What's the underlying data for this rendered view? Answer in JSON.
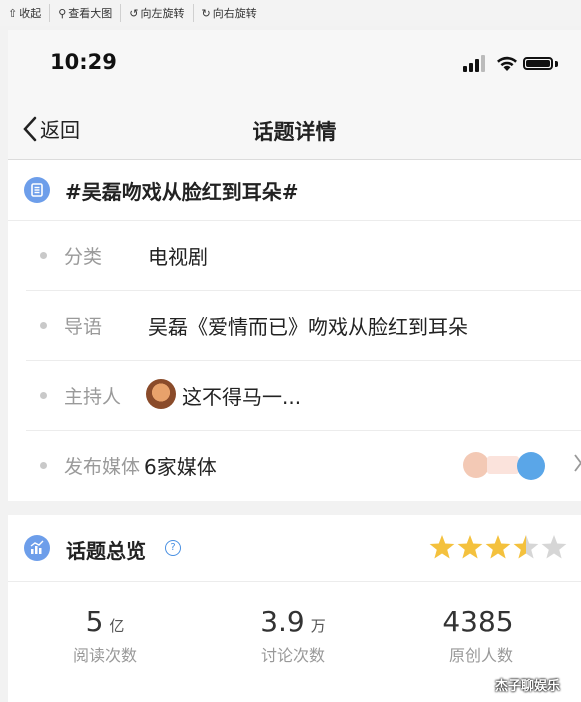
{
  "toolbar": {
    "items": [
      {
        "icon": "collapse-icon",
        "glyph": "⇧",
        "label": "收起"
      },
      {
        "icon": "search-icon",
        "glyph": "⚲",
        "label": "查看大图"
      },
      {
        "icon": "rotate-left-icon",
        "glyph": "↺",
        "label": "向左旋转"
      },
      {
        "icon": "rotate-right-icon",
        "glyph": "↻",
        "label": "向右旋转"
      }
    ]
  },
  "status_bar": {
    "time": "10:29"
  },
  "nav": {
    "back_label": "返回",
    "title": "话题详情"
  },
  "topic": {
    "name": "#吴磊吻戏从脸红到耳朵#",
    "rows": {
      "category": {
        "label": "分类",
        "value": "电视剧"
      },
      "intro": {
        "label": "导语",
        "value": "吴磊《爱情而已》吻戏从脸红到耳朵"
      },
      "host": {
        "label": "主持人",
        "value": "这不得马一..."
      },
      "media": {
        "label": "发布媒体",
        "value": "6家媒体"
      }
    }
  },
  "overview": {
    "title": "话题总览",
    "rating": 3.5,
    "rating_max": 5,
    "stats": [
      {
        "value": "5",
        "unit": "亿",
        "label": "阅读次数"
      },
      {
        "value": "3.9",
        "unit": "万",
        "label": "讨论次数"
      },
      {
        "value": "4385",
        "unit": "",
        "label": "原创人数"
      }
    ]
  },
  "watermark": "杰子聊娱乐",
  "colors": {
    "accent": "#6d9eea",
    "star": "#f4c13d",
    "star_empty": "#d6d6d6"
  }
}
